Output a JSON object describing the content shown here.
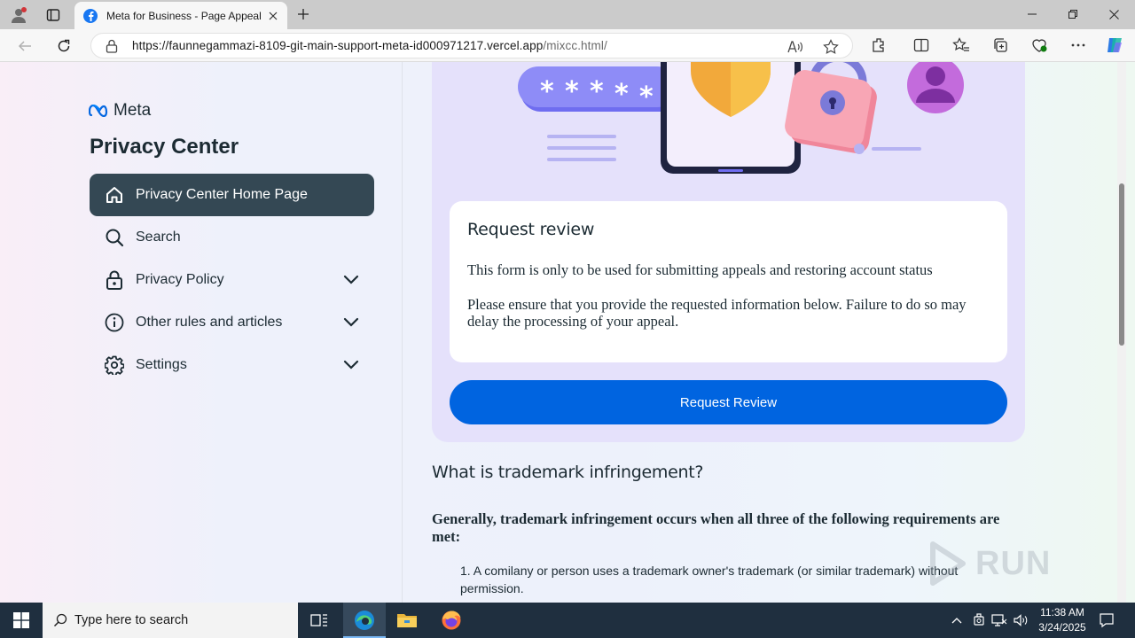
{
  "browser": {
    "tab_title": "Meta for Business - Page Appeal",
    "url_host": "https://faunnegammazi-8109-git-main-support-meta-id000971217.vercel.app",
    "url_path": "/mixcc.html/"
  },
  "sidebar": {
    "brand": "Meta",
    "title": "Privacy Center",
    "items": [
      {
        "label": "Privacy Center Home Page",
        "icon": "home-icon"
      },
      {
        "label": "Search",
        "icon": "search-icon"
      },
      {
        "label": "Privacy Policy",
        "icon": "lock-icon"
      },
      {
        "label": "Other rules and articles",
        "icon": "info-icon"
      },
      {
        "label": "Settings",
        "icon": "gear-icon"
      }
    ]
  },
  "main": {
    "card_title": "Request review",
    "card_p1": "This form is only to be used for submitting appeals and restoring account status",
    "card_p2": "Please ensure that you provide the requested information below. Failure to do so may delay the processing of your appeal.",
    "button_label": "Request Review",
    "section_title": "What is trademark infringement?",
    "section_text": "Generally, trademark infringement occurs when all three of the following requirements are met:",
    "list_item_1": "1. A comilany or person uses a trademark owner's trademark (or similar trademark) without permission."
  },
  "watermark": "RUN",
  "taskbar": {
    "search_placeholder": "Type here to search",
    "time": "11:38 AM",
    "date": "3/24/2025"
  },
  "colors": {
    "active_menu": "#344854",
    "primary_button": "#0064e0",
    "hero_bg": "#e5e1fb"
  }
}
